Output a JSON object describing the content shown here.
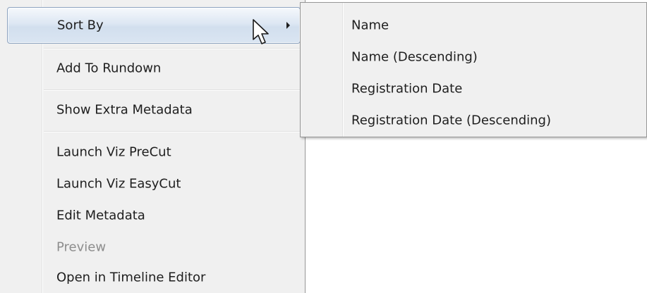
{
  "context_menu": {
    "items": [
      {
        "label": "Sort By",
        "has_submenu": true
      },
      {
        "label": "Add To Rundown"
      },
      {
        "label": "Show Extra Metadata"
      },
      {
        "label": "Launch Viz PreCut"
      },
      {
        "label": "Launch Viz EasyCut"
      },
      {
        "label": "Edit Metadata"
      },
      {
        "label": "Preview",
        "disabled": true
      },
      {
        "label": "Open in Timeline Editor"
      }
    ]
  },
  "sort_submenu": {
    "items": [
      {
        "label": "Name"
      },
      {
        "label": "Name (Descending)"
      },
      {
        "label": "Registration Date"
      },
      {
        "label": "Registration Date (Descending)"
      }
    ]
  },
  "colors": {
    "menu_background": "#f0f0f0",
    "highlight_border": "#8da3c0",
    "disabled_text": "#8d8d8d"
  },
  "icons": {
    "submenu_arrow": "chevron-right-icon",
    "cursor": "mouse-pointer-icon"
  }
}
